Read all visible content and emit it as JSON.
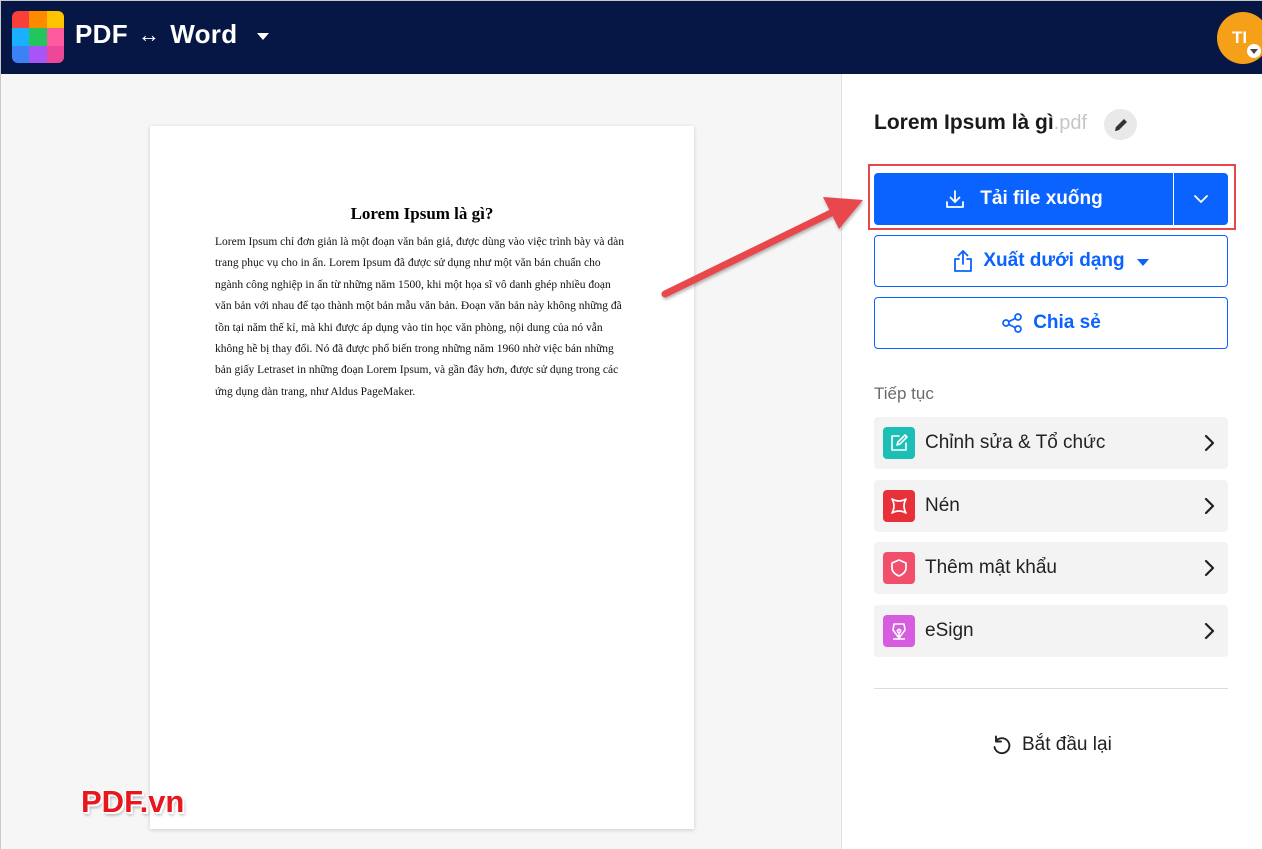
{
  "header": {
    "app_from": "PDF",
    "arrow": "↔",
    "app_to": "Word",
    "avatar_initials": "TI"
  },
  "document": {
    "title": "Lorem Ipsum là gì?",
    "body": "Lorem Ipsum chỉ đơn giản là một đoạn văn bản giả, được dùng vào việc trình bày và dàn trang phục vụ cho in ấn. Lorem Ipsum đã được sử dụng như một văn bản chuẩn cho ngành công nghiệp in ấn từ những năm 1500, khi một họa sĩ vô danh ghép nhiều đoạn văn bản với nhau để tạo thành một bản mẫu văn bản. Đoạn văn bản này không những đã tồn tại năm thế kỉ, mà khi được áp dụng vào tin học văn phòng, nội dung của nó vẫn không hề bị thay đổi. Nó đã được phổ biến trong những năm 1960 nhờ việc bán những bản giấy Letraset in những đoạn Lorem Ipsum, và gần đây hơn, được sử dụng trong các ứng dụng dàn trang, như Aldus PageMaker."
  },
  "watermark": "PDF.vn",
  "panel": {
    "file_name": "Lorem Ipsum là gì",
    "file_ext": ".pdf",
    "download_label": "Tải file xuống",
    "export_label": "Xuất dưới dạng",
    "share_label": "Chia sẻ",
    "continue_label": "Tiếp tục",
    "tools": [
      {
        "label": "Chỉnh sửa & Tổ chức",
        "icon": "edit-organize-icon",
        "color": "#1bbfb6"
      },
      {
        "label": "Nén",
        "icon": "compress-icon",
        "color": "#e8303a"
      },
      {
        "label": "Thêm mật khẩu",
        "icon": "shield-icon",
        "color": "#f0506b"
      },
      {
        "label": "eSign",
        "icon": "pen-nib-icon",
        "color": "#d65ce0"
      }
    ],
    "restart_label": "Bắt đầu lại"
  },
  "colors": {
    "header_bg": "#061746",
    "primary": "#0a63ff",
    "annotation": "#e8474b"
  }
}
